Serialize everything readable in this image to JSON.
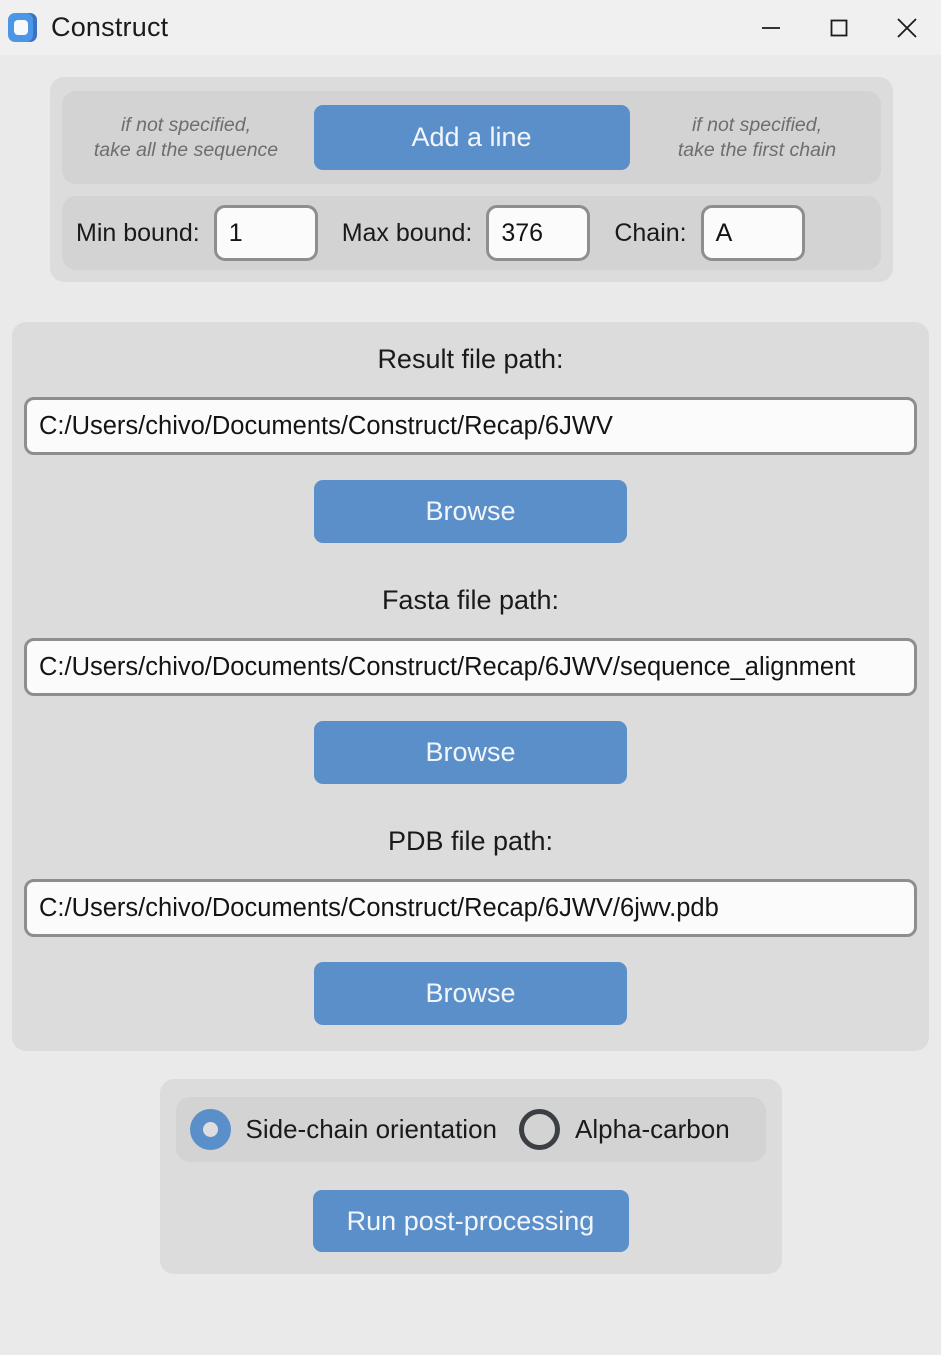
{
  "window": {
    "title": "Construct",
    "icon": "app-logo-icon",
    "controls": {
      "minimize": "minimize-icon",
      "maximize": "maximize-icon",
      "close": "close-icon"
    }
  },
  "top_section": {
    "hint_left": "if not specified,\ntake all the sequence",
    "hint_left_line1": "if not specified,",
    "hint_left_line2": "take all the sequence",
    "hint_right_line1": "if not specified,",
    "hint_right_line2": "take the first chain",
    "add_line_label": "Add a line",
    "fields": {
      "min_bound_label": "Min bound:",
      "min_bound_value": "1",
      "max_bound_label": "Max bound:",
      "max_bound_value": "376",
      "chain_label": "Chain:",
      "chain_value": "A"
    }
  },
  "paths": {
    "result": {
      "label": "Result file path:",
      "value": "C:/Users/chivo/Documents/Construct/Recap/6JWV",
      "browse_label": "Browse"
    },
    "fasta": {
      "label": "Fasta file path:",
      "value": "C:/Users/chivo/Documents/Construct/Recap/6JWV/sequence_alignment",
      "browse_label": "Browse"
    },
    "pdb": {
      "label": "PDB file path:",
      "value": "C:/Users/chivo/Documents/Construct/Recap/6JWV/6jwv.pdb",
      "browse_label": "Browse"
    }
  },
  "bottom_section": {
    "mode_options": [
      {
        "label": "Side-chain orientation",
        "selected": true
      },
      {
        "label": "Alpha-carbon",
        "selected": false
      }
    ],
    "option_side_chain_label": "Side-chain orientation",
    "option_alpha_carbon_label": "Alpha-carbon",
    "run_label": "Run post-processing"
  },
  "colors": {
    "accent_blue": "#5b8fc9",
    "window_bg": "#eaeaea",
    "panel_bg": "#dcdcdc",
    "subpanel_bg": "#d3d3d3",
    "titlebar_bg": "#f0f0f0",
    "field_border": "#8e8e8e",
    "hint_text": "#6e6e6e"
  }
}
